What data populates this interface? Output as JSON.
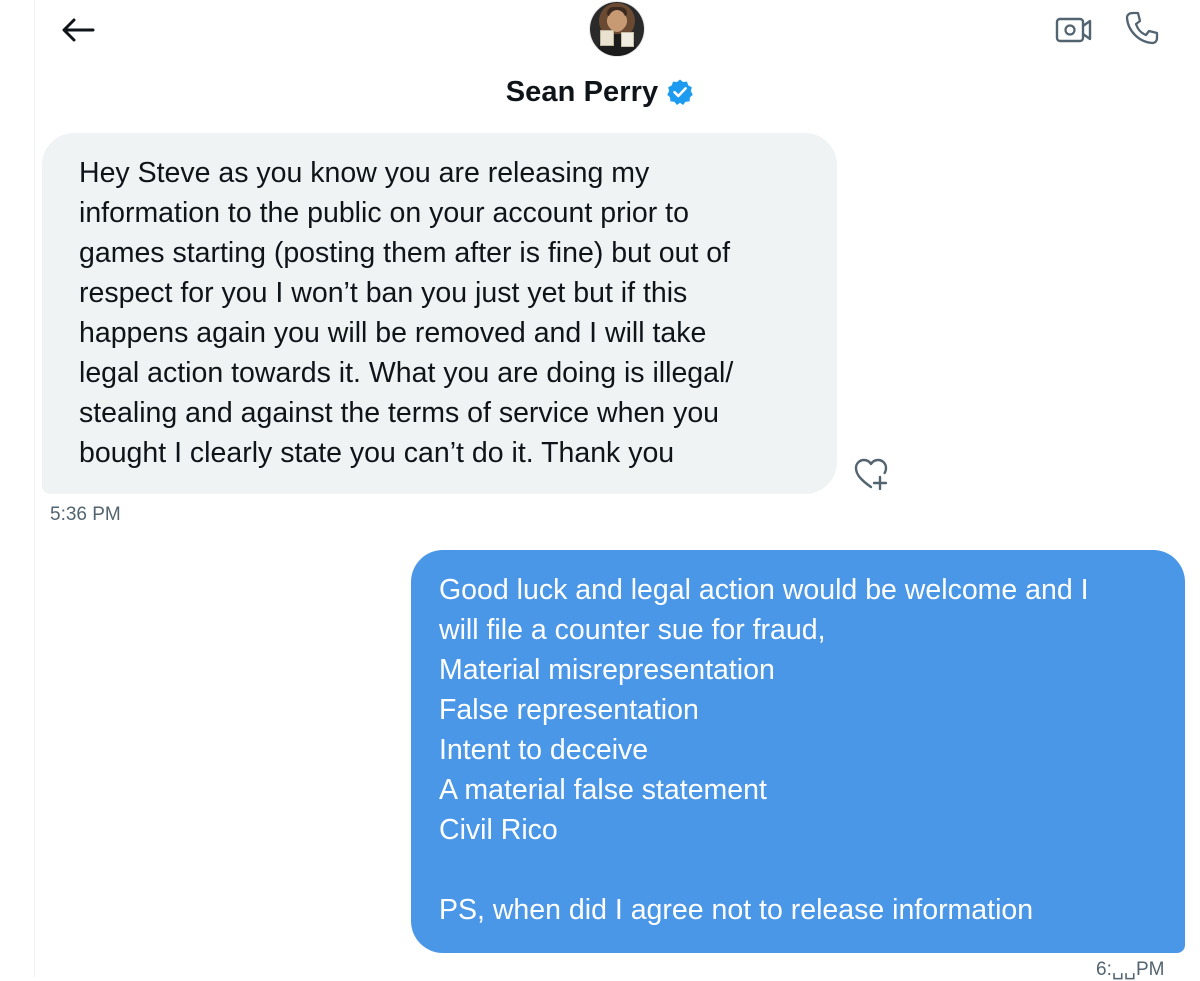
{
  "header": {
    "back_icon": "arrow-left-icon",
    "contact_name": "Sean Perry",
    "verified_icon": "verified-badge-icon",
    "video_icon": "video-call-icon",
    "call_icon": "phone-icon",
    "accent_color": "#1d9bf0"
  },
  "messages": [
    {
      "direction": "incoming",
      "text": "Hey Steve as you know you are releasing my\ninformation to the public on your account prior to\ngames starting (posting them after is fine) but out of\nrespect for you I won’t ban you just yet but if this\nhappens again you will be removed and I will take\nlegal action towards it. What you are doing is illegal/\nstealing and against the terms of service when you\nbought I clearly state you can’t do it. Thank you",
      "time": "5:36 PM",
      "react_icon": "heart-plus-icon",
      "bubble_color": "#eff3f4"
    },
    {
      "direction": "outgoing",
      "text": "Good luck and legal action would be welcome and I\nwill file a counter sue for fraud,\nMaterial misrepresentation\nFalse representation\nIntent to deceive\nA material false statement\nCivil Rico\n\nPS, when did I agree not to release information",
      "time": "6:␣␣PM",
      "bubble_color": "#4a97e8"
    }
  ]
}
